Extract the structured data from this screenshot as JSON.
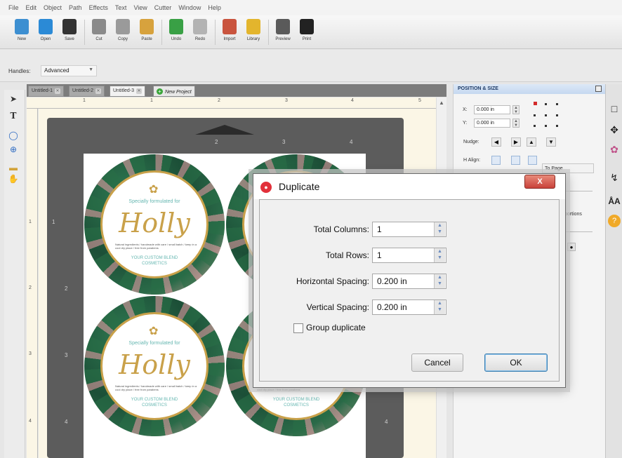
{
  "menu": [
    "File",
    "Edit",
    "Object",
    "Path",
    "Effects",
    "Text",
    "View",
    "Cutter",
    "Window",
    "Help"
  ],
  "toolbar": [
    {
      "label": "New",
      "icon": "new-document-icon",
      "color": "#3d8fd1"
    },
    {
      "label": "Open",
      "icon": "open-folder-icon",
      "color": "#2b8ad6"
    },
    {
      "label": "Save",
      "icon": "save-icon",
      "color": "#333333"
    },
    {
      "label": "Cut",
      "icon": "cut-icon",
      "color": "#8a8a8a"
    },
    {
      "label": "Copy",
      "icon": "copy-icon",
      "color": "#9a9a9a"
    },
    {
      "label": "Paste",
      "icon": "paste-icon",
      "color": "#d7a23d"
    },
    {
      "label": "Undo",
      "icon": "undo-icon",
      "color": "#39a045"
    },
    {
      "label": "Redo",
      "icon": "redo-icon",
      "color": "#b3b3b3"
    },
    {
      "label": "Import",
      "icon": "import-icon",
      "color": "#c9543e"
    },
    {
      "label": "Library",
      "icon": "library-icon",
      "color": "#e3b52d"
    },
    {
      "label": "Preview",
      "icon": "preview-icon",
      "color": "#5a5a5a"
    },
    {
      "label": "Print",
      "icon": "print-icon",
      "color": "#222222"
    }
  ],
  "handles": {
    "label": "Handles:",
    "value": "Advanced"
  },
  "tabs": [
    {
      "label": "Untitled-1"
    },
    {
      "label": "Untitled-2"
    },
    {
      "label": "Untitled-3"
    },
    {
      "label": "New Project"
    }
  ],
  "ruler_top": [
    "1",
    "1",
    "2",
    "3",
    "4",
    "5"
  ],
  "ruler_left": [
    "1",
    "2",
    "3",
    "4"
  ],
  "mat_nums": [
    "2",
    "3",
    "4",
    "1",
    "2",
    "3",
    "4",
    "4",
    "2"
  ],
  "labels": {
    "subtitle": "Specially formulated for",
    "name": "Holly",
    "fine_print": "Natural ingredients / handmade with care / small batch / keep in a cool dry place / free from parabens",
    "footer_line1": "YOUR CUSTOM BLEND",
    "footer_line2": "COSMETICS"
  },
  "panel": {
    "title": "POSITION & SIZE",
    "x_label": "X:",
    "x_value": "0.000 in",
    "y_label": "Y:",
    "y_value": "0.000 in",
    "nudge_label": "Nudge:",
    "halign_label": "H Align:",
    "relative_to": "To Page",
    "proportions": "portions"
  },
  "dialog": {
    "title": "Duplicate",
    "close": "X",
    "total_columns_label": "Total Columns:",
    "total_columns_value": "1",
    "total_rows_label": "Total Rows:",
    "total_rows_value": "1",
    "h_spacing_label": "Horizontal Spacing:",
    "h_spacing_value": "0.200 in",
    "v_spacing_label": "Vertical Spacing:",
    "v_spacing_value": "0.200 in",
    "group_label": "Group duplicate",
    "cancel": "Cancel",
    "ok": "OK"
  }
}
